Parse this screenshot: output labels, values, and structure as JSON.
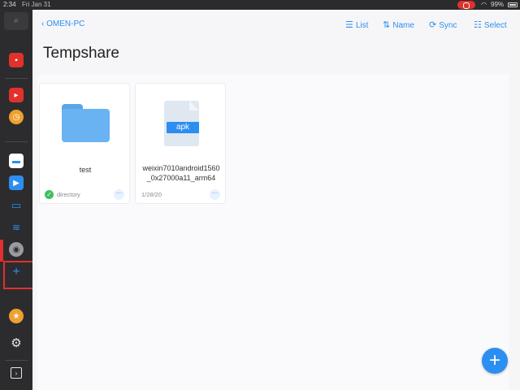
{
  "statusbar": {
    "time": "2:34",
    "date": "Fri Jan 31",
    "battery": "99%"
  },
  "sidebar": {
    "add_label": "+"
  },
  "header": {
    "back_label": "OMEN-PC",
    "list_label": "List",
    "sort_label": "Name",
    "sync_label": "Sync",
    "select_label": "Select",
    "title": "Tempshare"
  },
  "files": [
    {
      "name": "test",
      "meta": "directory",
      "type": "folder"
    },
    {
      "name_line1": "weixin7010android1560",
      "name_line2": "_0x27000a11_arm64",
      "meta": "1/28/20",
      "type": "apk",
      "badge": "apk"
    }
  ],
  "fab_label": "+",
  "colors": {
    "accent": "#2c8ef0",
    "sidebar_bg": "#2c2c2f",
    "highlight": "#e0312c"
  }
}
